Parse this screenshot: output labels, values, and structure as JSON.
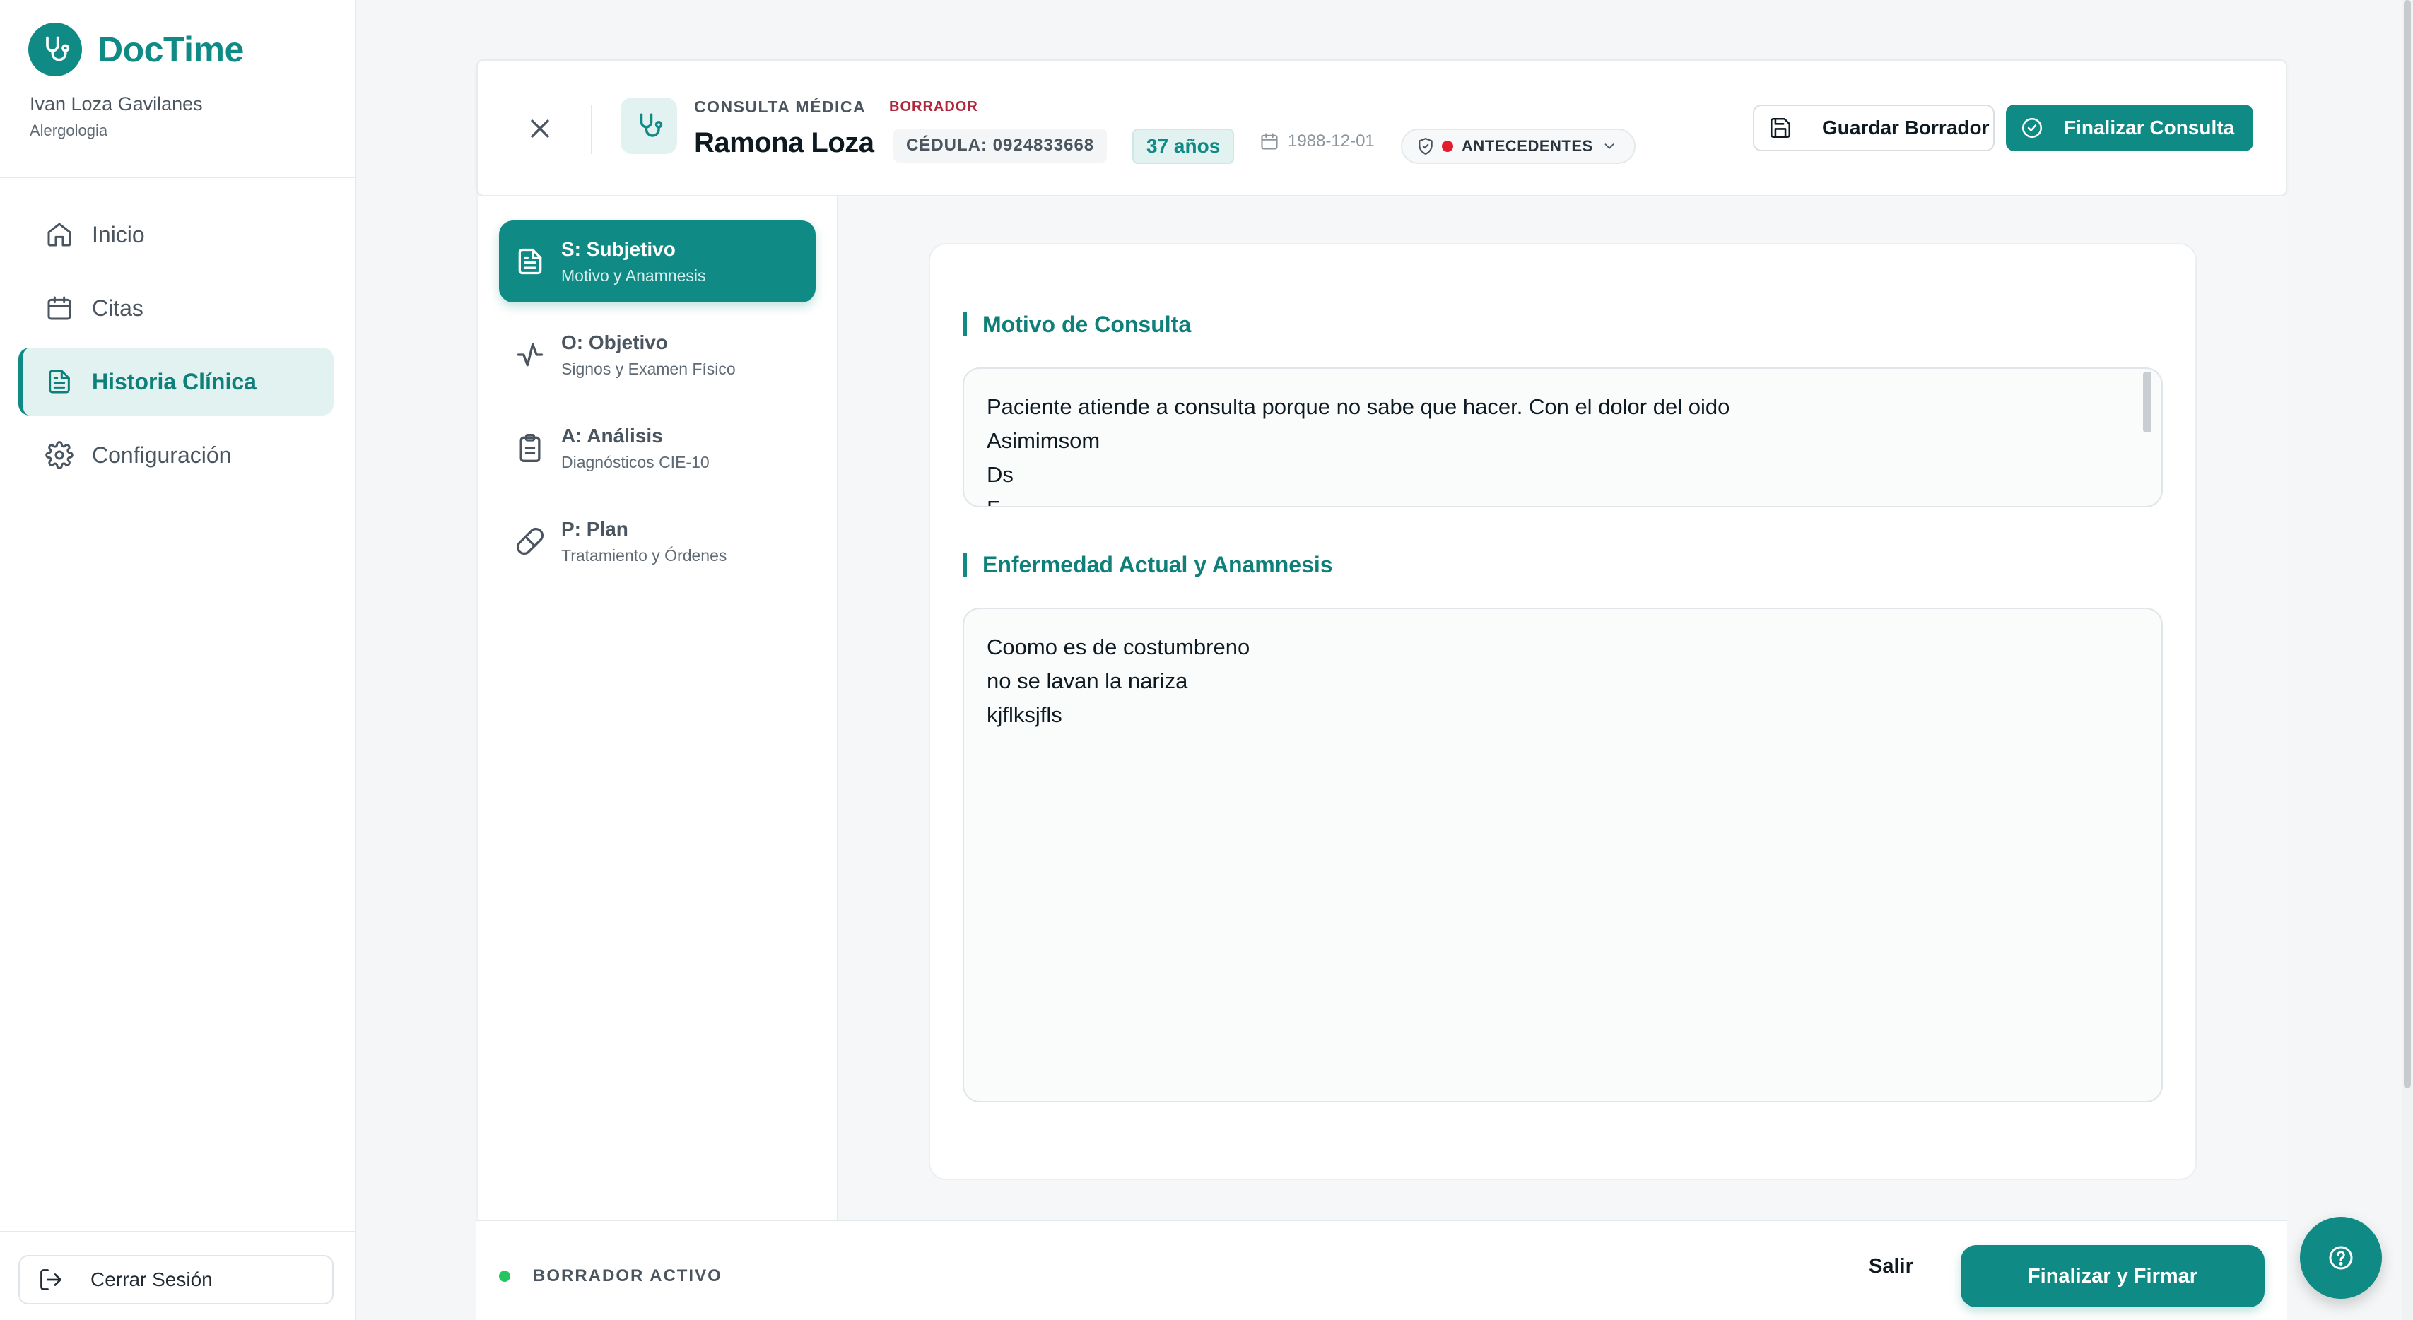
{
  "app": {
    "name": "DocTime",
    "user_name": "Ivan Loza Gavilanes",
    "user_role": "Alergologia"
  },
  "nav": {
    "items": [
      {
        "label": "Inicio",
        "icon": "home-icon",
        "active": false
      },
      {
        "label": "Citas",
        "icon": "calendar-icon",
        "active": false
      },
      {
        "label": "Historia Clínica",
        "icon": "document-icon",
        "active": true
      },
      {
        "label": "Configuración",
        "icon": "gear-icon",
        "active": false
      }
    ],
    "logout_label": "Cerrar Sesión"
  },
  "header": {
    "kicker": "CONSULTA MÉDICA",
    "status": "BORRADOR",
    "patient_name": "Ramona Loza",
    "cedula": "CÉDULA: 0924833668",
    "age": "37 años",
    "dob": "1988-12-01",
    "antecedentes": "ANTECEDENTES",
    "save_draft_label": "Guardar Borrador",
    "finish_label": "Finalizar Consulta"
  },
  "soap": {
    "items": [
      {
        "title": "S: Subjetivo",
        "subtitle": "Motivo y Anamnesis",
        "icon": "document-icon",
        "active": true
      },
      {
        "title": "O: Objetivo",
        "subtitle": "Signos y Examen Físico",
        "icon": "activity-icon",
        "active": false
      },
      {
        "title": "A: Análisis",
        "subtitle": "Diagnósticos CIE-10",
        "icon": "clipboard-icon",
        "active": false
      },
      {
        "title": "P: Plan",
        "subtitle": "Tratamiento y Órdenes",
        "icon": "pill-icon",
        "active": false
      }
    ]
  },
  "form": {
    "motivo": {
      "title": "Motivo de Consulta",
      "lines": [
        "Paciente atiende a consulta porque no sabe que hacer. Con el dolor del oido",
        "Asimimsom",
        "Ds",
        "F"
      ]
    },
    "enfermedad": {
      "title": "Enfermedad Actual y Anamnesis",
      "lines": [
        "Coomo es de costumbreno",
        "no se lavan la nariza",
        "kjflksjfls"
      ]
    }
  },
  "footer": {
    "status_label": "BORRADOR ACTIVO",
    "exit_label": "Salir",
    "sign_label": "Finalizar y Firmar"
  },
  "colors": {
    "primary": "#0f8a85",
    "primary_light": "#e2f2f1",
    "danger": "#e11d2e",
    "draft_tag": "#b0263c",
    "active_dot": "#22c55e"
  }
}
